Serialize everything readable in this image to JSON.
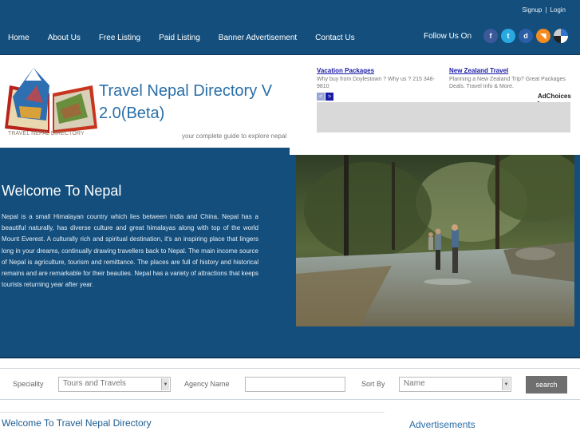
{
  "topbar": {
    "signup": "Signup",
    "login": "Login",
    "separator": "|",
    "nav": [
      "Home",
      "About Us",
      "Free Listing",
      "Paid Listing",
      "Banner Advertisement",
      "Contact Us"
    ],
    "follow_label": "Follow Us On",
    "social": [
      {
        "icon": "facebook-icon",
        "glyph": "f",
        "color": "#3b5998"
      },
      {
        "icon": "twitter-icon",
        "glyph": "t",
        "color": "#29a9e1"
      },
      {
        "icon": "diigo-icon",
        "glyph": "d",
        "color": "#2a5ea8"
      },
      {
        "icon": "rss-icon",
        "glyph": "◥",
        "color": "#f58a1f"
      },
      {
        "icon": "delicious-icon",
        "glyph": "",
        "color": "#3274d0"
      }
    ]
  },
  "header": {
    "logo_caption": "TRAVEL NEPAL DIRECTORY",
    "title": "Travel Nepal Directory V 2.0(Beta)",
    "tagline": "your complete guide to explore nepal"
  },
  "ads": {
    "items": [
      {
        "title": "Vacation Packages",
        "text": "Why buy from Doylestown ? Why us ? 215 348-9810"
      },
      {
        "title": "New Zealand Travel",
        "text": "Planning a New Zealand Trip? Great Packages Deals. Travel Info & More."
      }
    ],
    "prev": "<",
    "next": ">",
    "adchoices": "AdChoices ▷"
  },
  "hero": {
    "heading": "Welcome To Nepal",
    "paragraph": "Nepal is a small Himalayan country which lies between India and China. Nepal has a beautiful naturally, has diverse culture and great himalayas along with top of the world Mount Everest. A culturally rich and spiritual destination, it's an inspiring place that lingers long in your dreams, continually drawing travellers back to Nepal. The main income source of Nepal is agriculture, tourism and remittance. The places are full of history and historical remains and are remarkable for their beauties. Nepal has a variety of attractions that keeps tourists returning year after year."
  },
  "search": {
    "speciality_label": "Speciality",
    "speciality_value": "Tours and Travels",
    "agency_label": "Agency Name",
    "agency_value": "",
    "sortby_label": "Sort By",
    "sortby_value": "Name",
    "button": "search"
  },
  "bottom": {
    "heading": "Welcome To Travel Nepal Directory",
    "advertisements": "Advertisements"
  },
  "colors": {
    "brand_blue": "#134e7c",
    "title_blue": "#2a6ea8"
  }
}
